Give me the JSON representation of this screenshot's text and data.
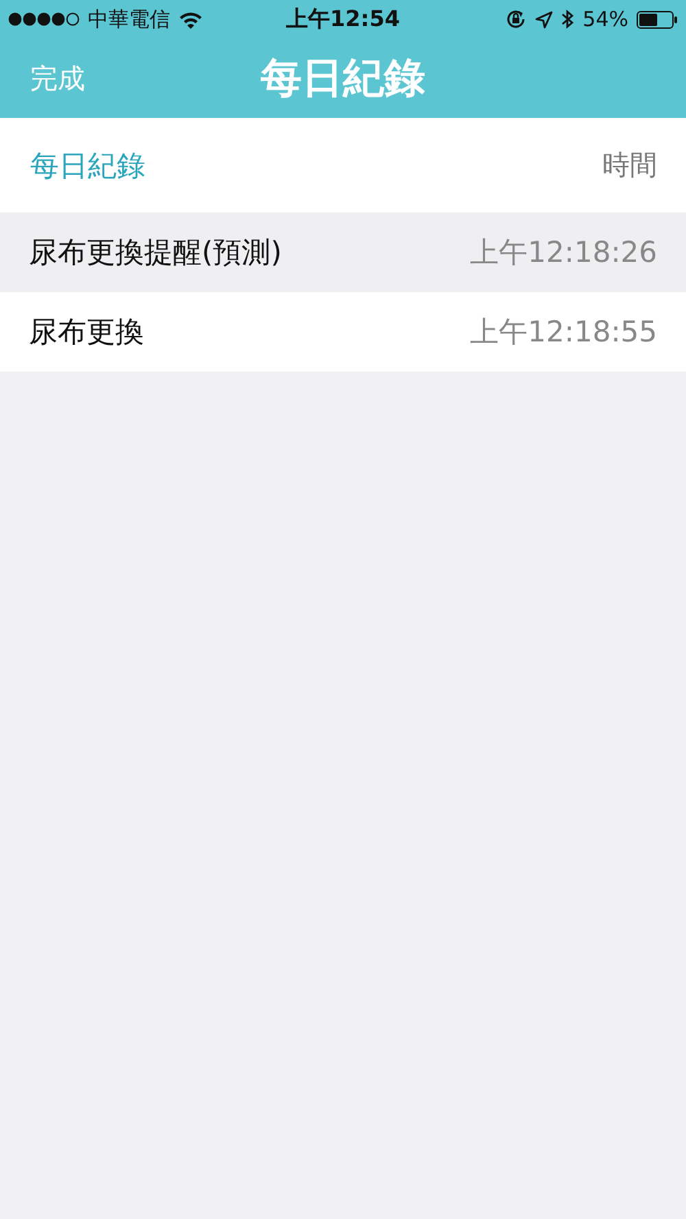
{
  "status_bar": {
    "carrier": "中華電信",
    "time": "上午12:54",
    "battery_percent": "54%"
  },
  "nav_bar": {
    "left_button": "完成",
    "title": "每日紀錄"
  },
  "list_header": {
    "title": "每日紀錄",
    "column": "時間"
  },
  "records": [
    {
      "name": "尿布更換提醒(預測)",
      "time": "上午12:18:26"
    },
    {
      "name": "尿布更換",
      "time": "上午12:18:55"
    }
  ]
}
